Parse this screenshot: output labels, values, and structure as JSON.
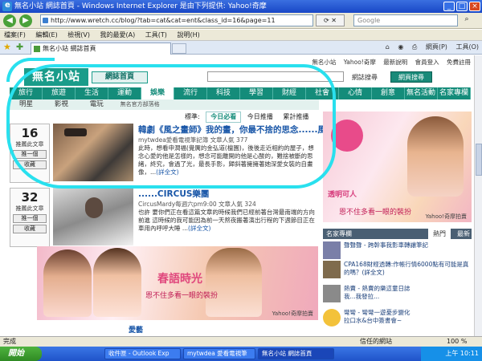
{
  "window": {
    "title": "無名小站 網誌首頁 - Windows Internet Explorer 是由下列提供: Yahoo!奇摩",
    "url": "http://www.wretch.cc/blog/?tab=cat&cat=ent&class_id=16&page=11",
    "search_placeholder": "Google",
    "menus": [
      "檔案(F)",
      "編輯(E)",
      "檢視(V)",
      "我的最愛(A)",
      "工具(T)",
      "說明(H)"
    ],
    "tab_title": "無名小站 網誌首頁",
    "toolbar_tools": [
      "網頁(P)",
      "工具(O)"
    ]
  },
  "site": {
    "top_links": [
      "無名小站",
      "Yahoo!奇摩",
      "最新說明",
      "會員登入",
      "免費註冊"
    ],
    "logo": "無名小站",
    "home_label": "網誌首頁",
    "search_type": "網誌搜尋",
    "search_button": "網頁搜尋",
    "categories": [
      "旅行",
      "旅遊",
      "生活",
      "運動",
      "娛樂",
      "流行",
      "科技",
      "學習",
      "財經",
      "社會",
      "心情",
      "創意",
      "無名活動",
      "名家專欄"
    ],
    "active_category": "娛樂",
    "subcategories": [
      "明星",
      "影視",
      "電玩"
    ],
    "sub_label": "無名官方部落格",
    "list_tabs": [
      "今日必看",
      "今日推播",
      "累計推播"
    ],
    "list_label": "標準:"
  },
  "entries": [
    {
      "count": "16",
      "count_label": "推薦此文章",
      "btn1": "推一個",
      "btn2": "收藏",
      "title": "韓劇《風之畫師》我的畫，你最不捨的思念......風",
      "meta": "mytwdea愛看電視筆記簿  文章人氣 377",
      "body": "此時，想看申潤福(覺厲的金弘道(檀園)，後後走近相約的屋子，想念心愛的他是怎樣的，想念可能離開的他是心酸的，難捨被斷的思緒，終究，會過了光，最長手影，歸斜著擁擁著她深愛女裝的自畫像，...",
      "more": "(詳全文)"
    },
    {
      "count": "32",
      "count_label": "推薦此文章",
      "btn1": "推一個",
      "btn2": "收藏",
      "title": "......CIRCUS樂團",
      "meta": "CircusMardy每週六pm9:00  文章人氣 324",
      "body": "也許 要你們正在看這篇文章的時候我們已經前著台灣最南端的方向前進 這時候的我可能因為前一天熬夜搬著演出行程的下週節目正在車用內呼呼大睡 ...",
      "more": "(詳全文)"
    }
  ],
  "right_ad": {
    "line1": "透明可人",
    "line2": "恩不住多看一眼的裝扮",
    "credit": "Yahoo!奇摩拍賣"
  },
  "side": {
    "head": "名家專欄",
    "tab_hot": "熱門",
    "tab_new": "最新",
    "items": [
      "聲聲聲 - 跨幹事我影車轉讓筆記",
      "CPA168財經透轉:作帳行情6000點有可能是真的嗎？(詳全文)",
      "熱賣 - 熱賣的樂這童日誌",
      "我...我發拉..."
    ],
    "last": "彎彎 - 彎彎一遊憂步變化",
    "last2": "拉口水&台中簽書會~"
  },
  "banner": {
    "line1": "春語時光",
    "line2": "恩不住多看一眼的裝扮",
    "credit": "Yahoo!奇摩拍賣"
  },
  "bottom_title": "愛藝",
  "status": {
    "left": "完成",
    "zone": "信任的網站",
    "zoom": "100 %"
  },
  "taskbar": {
    "start": "開始",
    "tasks": [
      "收件匣 - Outlook Exp",
      "mytwdea 愛看電視筆",
      "無名小站 網誌首頁"
    ],
    "clock": "上午 10:11"
  }
}
